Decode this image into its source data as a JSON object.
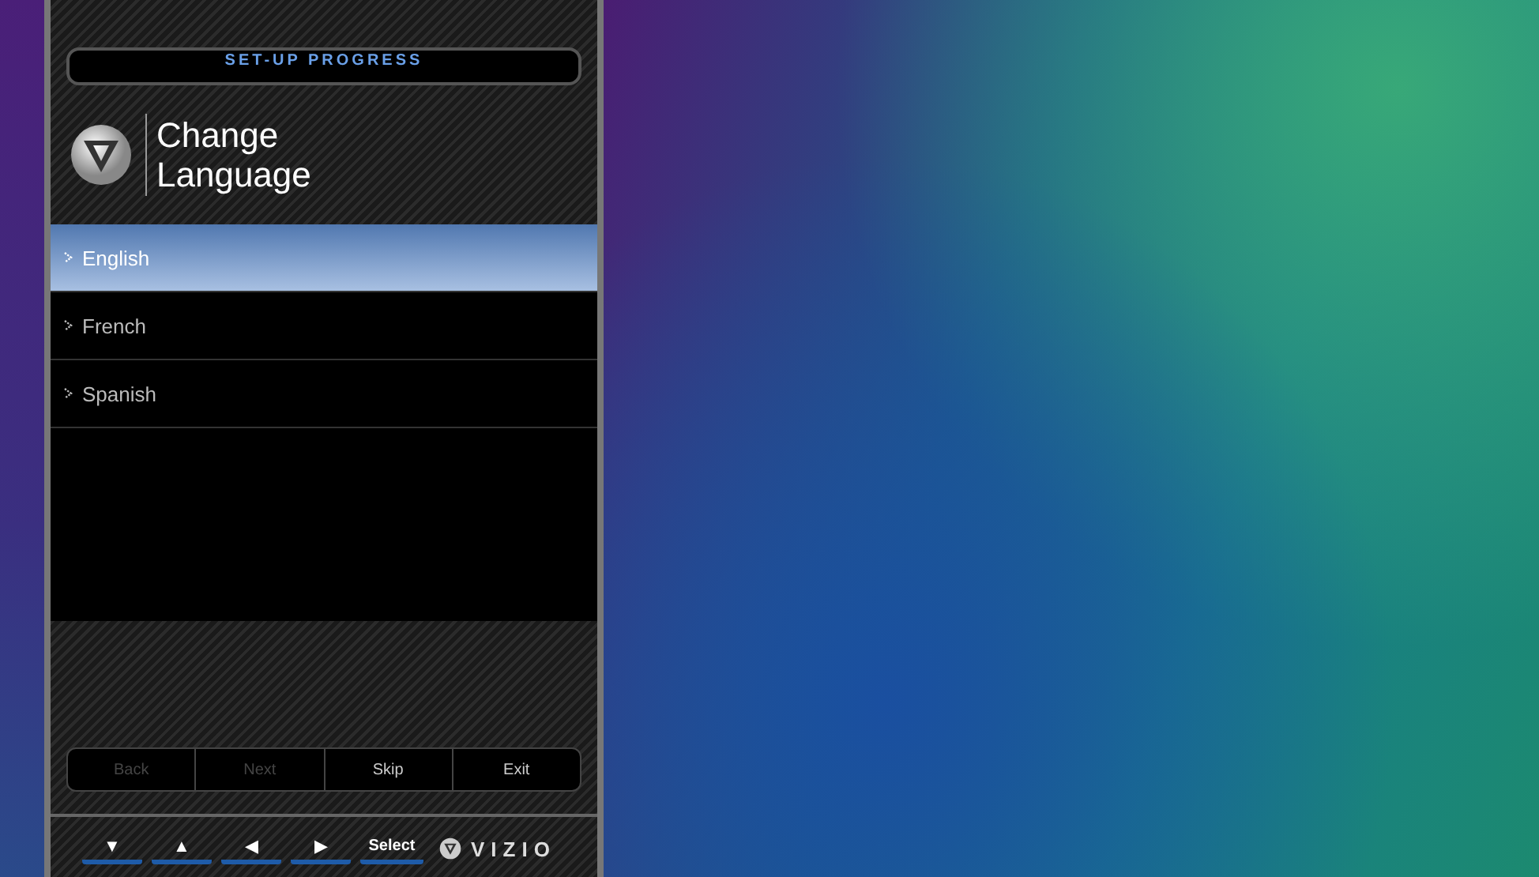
{
  "setup_progress": {
    "label": "SET-UP PROGRESS"
  },
  "title": "Change Language",
  "languages": [
    {
      "label": "English",
      "selected": true
    },
    {
      "label": "French",
      "selected": false
    },
    {
      "label": "Spanish",
      "selected": false
    }
  ],
  "nav_buttons": [
    {
      "label": "Back",
      "disabled": true
    },
    {
      "label": "Next",
      "disabled": true
    },
    {
      "label": "Skip",
      "disabled": false
    },
    {
      "label": "Exit",
      "disabled": false
    }
  ],
  "remote_keys": [
    {
      "kind": "glyph",
      "label": "▼"
    },
    {
      "kind": "glyph",
      "label": "▲"
    },
    {
      "kind": "glyph",
      "label": "◀"
    },
    {
      "kind": "glyph",
      "label": "▶"
    },
    {
      "kind": "word",
      "label": "Select"
    }
  ],
  "brand": "VIZIO"
}
